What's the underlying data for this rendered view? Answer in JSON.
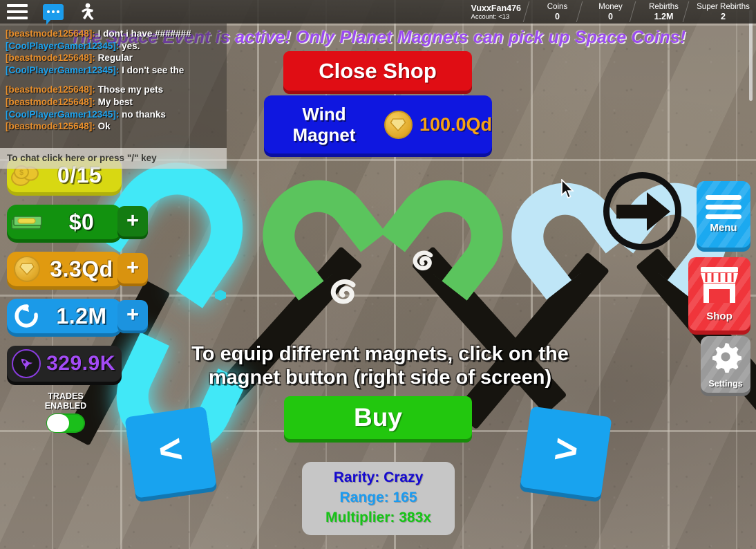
{
  "topbar": {
    "icons": [
      {
        "name": "hamburger-menu-icon",
        "label": "menu"
      },
      {
        "name": "chat-bubble-icon",
        "label": "chat"
      },
      {
        "name": "emote-person-icon",
        "label": "emotes"
      }
    ],
    "account": {
      "username": "VuxxFan476",
      "account_label": "Account: <13"
    },
    "stats": [
      {
        "label": "Coins",
        "value": "0"
      },
      {
        "label": "Money",
        "value": "0"
      },
      {
        "label": "Rebirths",
        "value": "1.2M"
      },
      {
        "label": "Super Rebirths",
        "value": "2"
      }
    ]
  },
  "chat": {
    "lines": [
      {
        "name": "[beastmode125648]:",
        "color": "#e88f2c",
        "text": "I dont i have #######"
      },
      {
        "name": "[CoolPlayerGamer12345]:",
        "color": "#1ea4f0",
        "text": "yes."
      },
      {
        "name": "[beastmode125648]:",
        "color": "#e88f2c",
        "text": "Regular"
      },
      {
        "name": "[CoolPlayerGamer12345]:",
        "color": "#1ea4f0",
        "text": "I don't see the"
      },
      {
        "gap": true
      },
      {
        "name": "[beastmode125648]:",
        "color": "#e88f2c",
        "text": "Those my pets"
      },
      {
        "name": "[beastmode125648]:",
        "color": "#e88f2c",
        "text": "My best"
      },
      {
        "name": "[CoolPlayerGamer12345]:",
        "color": "#1ea4f0",
        "text": "no thanks"
      },
      {
        "name": "[beastmode125648]:",
        "color": "#e88f2c",
        "text": "Ok"
      }
    ],
    "input_placeholder": "To chat click here or press \"/\" key"
  },
  "event_banner": {
    "text": "The Space Event is active! Only Planet Magnets can pick up Space Coins!",
    "color": "#9b4bf0"
  },
  "left_panels": [
    {
      "name": "capacity",
      "icon": "coin-stack-icon",
      "value": "0/15",
      "color": "#d8d812",
      "plus": false
    },
    {
      "name": "money",
      "icon": "cash-stack-icon",
      "value": "$0",
      "color": "#12920f",
      "plus": true,
      "plus_color": "#147c12"
    },
    {
      "name": "gems",
      "icon": "gem-coin-icon",
      "value": "3.3Qd",
      "color": "#e09a10",
      "plus": true,
      "plus_color": "#d9930f"
    },
    {
      "name": "rebirths",
      "icon": "rebirth-arrow-icon",
      "value": "1.2M",
      "color": "#1b9ae8",
      "plus": true,
      "plus_color": "#1c93df"
    },
    {
      "name": "super-rebirths",
      "icon": "rocket-icon",
      "value": "329.9K",
      "color": "#242424",
      "value_color": "#a34bf5",
      "plus": false
    }
  ],
  "trades": {
    "label_line1": "TRADES",
    "label_line2": "ENABLED",
    "enabled": true,
    "on_color": "#1bbf1b"
  },
  "shop": {
    "close_label": "Close Shop",
    "item_name_line1": "Wind",
    "item_name_line2": "Magnet",
    "price": "100.0Qd",
    "price_icon": "gem-coin-icon",
    "buy_label": "Buy",
    "prev_label": "<",
    "next_label": ">",
    "info": {
      "rarity": "Rarity: Crazy",
      "range": "Range: 165",
      "multiplier": "Multiplier: 383x"
    }
  },
  "hint": {
    "line1": "To equip different magnets, click on the",
    "line2": "magnet button (right side of screen)"
  },
  "side_buttons": [
    {
      "name": "menu",
      "label": "Menu",
      "icon": "hamburger-menu-icon",
      "color": "#1ba9f0"
    },
    {
      "name": "shop",
      "label": "Shop",
      "icon": "storefront-icon",
      "color": "#f0353b"
    },
    {
      "name": "settings",
      "label": "Settings",
      "icon": "gear-icon",
      "color": "#9a9a9a"
    }
  ],
  "indicators": {
    "pointer_arrow": "arrow-right-icon",
    "cursor": "mouse-cursor-icon"
  }
}
